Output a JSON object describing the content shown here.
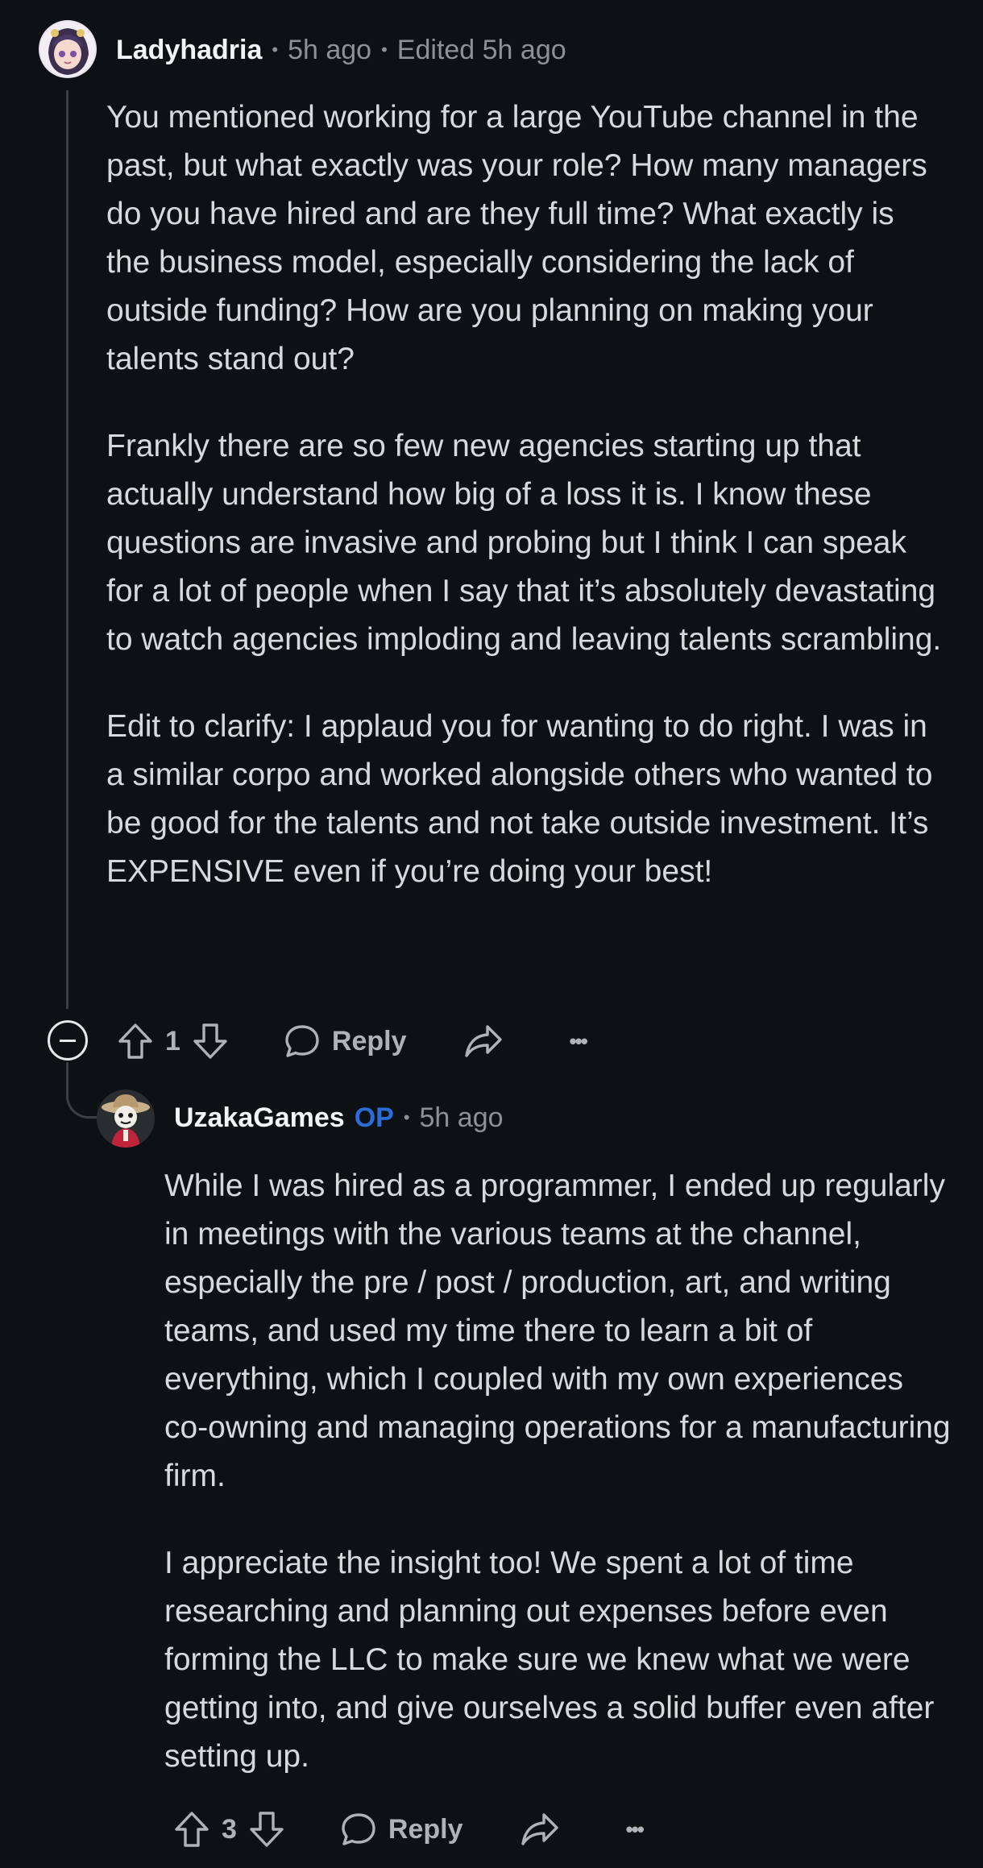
{
  "comments": [
    {
      "username": "Ladyhadria",
      "time": "5h ago",
      "edited": "Edited 5h ago",
      "paragraphs": [
        "You mentioned working for a large YouTube channel in the past, but what exactly was your role? How many managers do you have hired and are they full time? What exactly is the business model, especially considering the lack of outside funding? How are you planning on making your talents stand out?",
        "Frankly there are so few new agencies starting up that actually understand how big of a loss it is. I know these questions are invasive and probing but I think I can speak for a lot of people when I say that it’s absolutely devastating to watch agencies imploding and leaving talents scrambling.",
        "Edit to clarify: I applaud you for wanting to do right. I was in a similar corpo and worked alongside others who wanted to be good for the talents and not take outside investment. It’s EXPENSIVE even if you’re doing your best!"
      ],
      "score": "1",
      "reply_label": "Reply",
      "more_label": "•••"
    },
    {
      "username": "UzakaGames",
      "op_badge": "OP",
      "time": "5h ago",
      "paragraphs": [
        "While I was hired as a programmer, I ended up regularly in meetings with the various teams at the channel, especially the pre / post / production, art, and writing teams, and used my time there to learn a bit of everything, which I coupled with my own experiences co-owning and managing operations for a manufacturing firm.",
        "I appreciate the insight too! We spent a lot of time researching and planning out expenses before even forming the LLC to make sure we knew what we were getting into, and give ourselves a solid buffer even after setting up."
      ],
      "score": "3",
      "reply_label": "Reply",
      "more_label": "•••"
    }
  ],
  "separator": "•",
  "icons": {
    "upvote": "upvote-arrow-icon",
    "downvote": "downvote-arrow-icon",
    "reply": "speech-bubble-icon",
    "share": "share-arrow-icon",
    "more": "ellipsis-icon",
    "collapse": "collapse-minus-icon"
  },
  "colors": {
    "background": "#0e1113",
    "text": "#d7dadc",
    "meta": "#8b9196",
    "op_badge": "#2b6cd6"
  }
}
